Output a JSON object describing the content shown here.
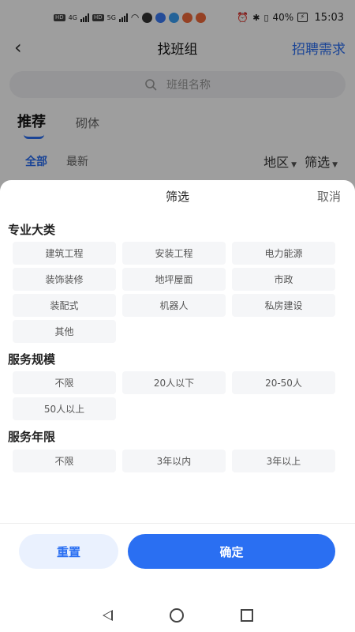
{
  "status": {
    "badge1": "HD",
    "badge2": "HD",
    "net1": "4G",
    "net2": "5G",
    "battery": "40%",
    "time": "15:03"
  },
  "nav": {
    "title": "找班组",
    "recruit": "招聘需求"
  },
  "search": {
    "placeholder": "班组名称"
  },
  "tabs": [
    "推荐",
    "砌体"
  ],
  "filters": {
    "all": "全部",
    "latest": "最新",
    "region": "地区",
    "screen": "筛选"
  },
  "sheet": {
    "title": "筛选",
    "cancel": "取消",
    "sections": [
      {
        "title": "专业大类",
        "options": [
          "建筑工程",
          "安装工程",
          "电力能源",
          "装饰装修",
          "地坪屋面",
          "市政",
          "装配式",
          "机器人",
          "私房建设",
          "其他"
        ]
      },
      {
        "title": "服务规模",
        "options": [
          "不限",
          "20人以下",
          "20-50人",
          "50人以上"
        ]
      },
      {
        "title": "服务年限",
        "options": [
          "不限",
          "3年以内",
          "3年以上"
        ]
      }
    ],
    "reset": "重置",
    "confirm": "确定"
  },
  "colors": {
    "accent": "#2a6ff2",
    "chip_bg": "#f5f6f8",
    "reset_bg": "#eaf1fe"
  }
}
